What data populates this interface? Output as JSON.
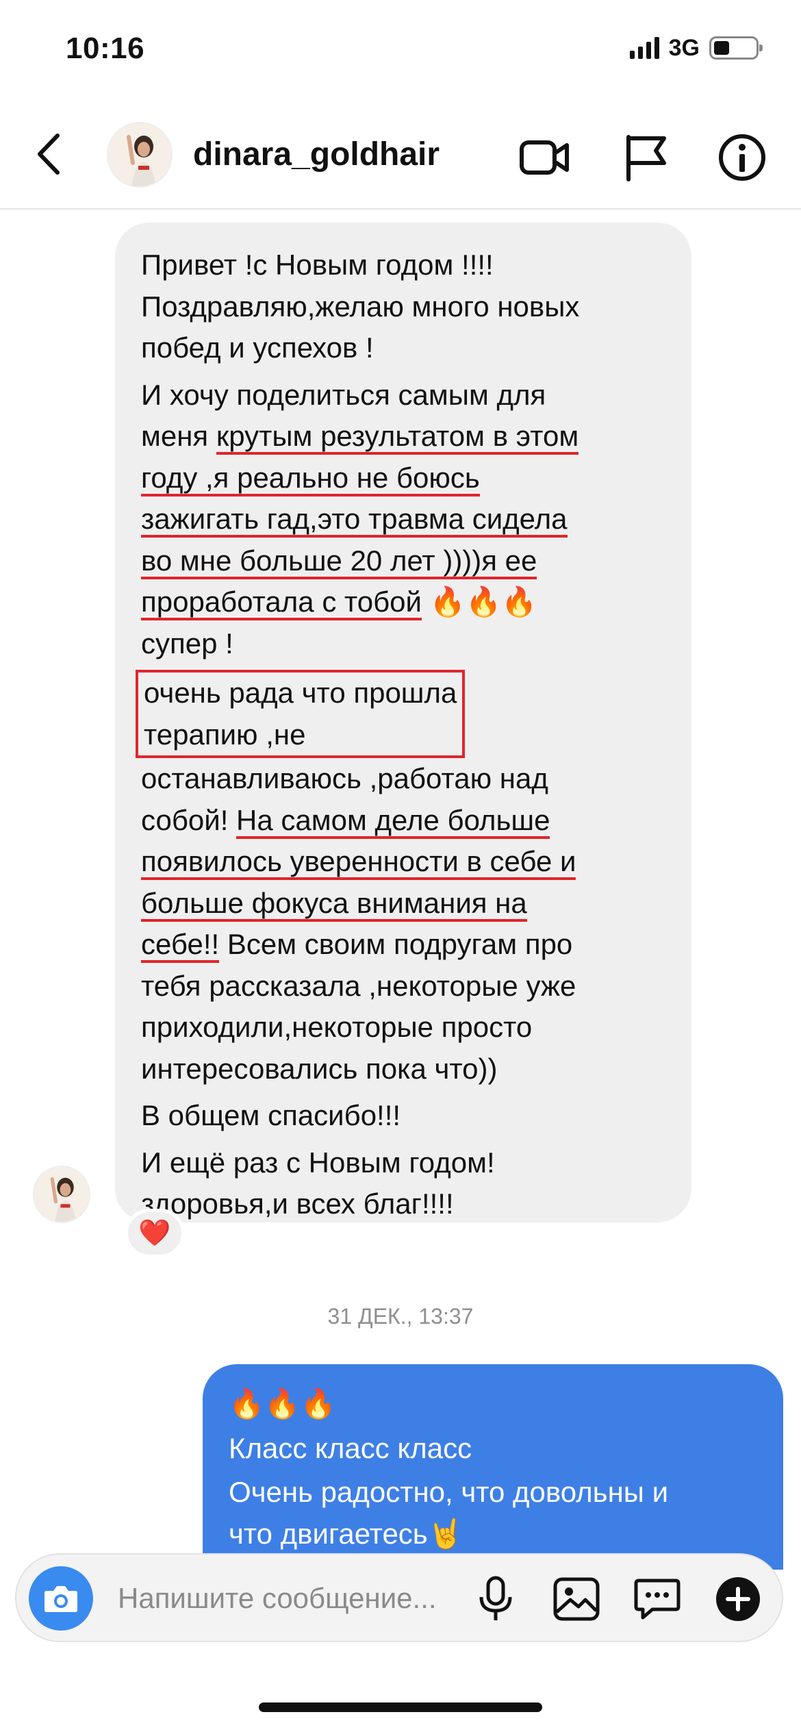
{
  "status_bar": {
    "time": "10:16",
    "network": "3G"
  },
  "header": {
    "username": "dinara_goldhair"
  },
  "incoming_message": {
    "paragraphs": [
      {
        "lines": [
          "Привет !с Новым годом !!!!",
          "Поздравляю,желаю много новых",
          "побед и успехов !"
        ]
      },
      {
        "lines": [
          {
            "pre": "И хочу поделиться самым для",
            "ul": ""
          },
          {
            "pre": "меня ",
            "ul": "крутым результатом в этом"
          },
          {
            "pre": "",
            "ul": "году ,я реально не боюсь"
          },
          {
            "pre": "",
            "ul": "зажигать гад,это травма сидела"
          },
          {
            "pre": "",
            "ul": "во мне больше 20 лет ))))я ее"
          },
          {
            "pre": "",
            "ul": "проработала с тобой",
            "post": " 🔥🔥🔥"
          },
          {
            "pre": "супер !",
            "ul": ""
          }
        ]
      },
      {
        "boxed": [
          "очень рада что прошла",
          "терапию ,не"
        ],
        "lines": [
          {
            "pre": "останавливаюсь ,работаю над",
            "ul": ""
          },
          {
            "pre": "собой! ",
            "ul": "На самом деле больше"
          },
          {
            "pre": "",
            "ul": "появилось уверенности в себе и"
          },
          {
            "pre": "",
            "ul": "больше фокуса внимания на"
          },
          {
            "pre": "",
            "ul": "себе!!",
            "post": " Всем своим подругам про"
          },
          {
            "pre": "тебя рассказала ,некоторые уже",
            "ul": ""
          },
          {
            "pre": "приходили,некоторые просто",
            "ul": ""
          },
          {
            "pre": "интересовались пока что))",
            "ul": ""
          }
        ]
      },
      {
        "lines": [
          "В общем спасибо!!!"
        ]
      },
      {
        "lines": [
          "И ещё раз с Новым годом!",
          "здоровья,и всех благ!!!!"
        ]
      }
    ],
    "reaction": "❤️"
  },
  "timestamp": "31 ДЕК., 13:37",
  "outgoing_message": {
    "paragraphs": [
      {
        "lines": [
          "🔥🔥🔥"
        ]
      },
      {
        "lines": [
          "Класс класс класс"
        ]
      },
      {
        "lines": [
          "Очень радостно, что довольны и",
          "что двигаетесь🤘"
        ]
      }
    ]
  },
  "composer": {
    "placeholder": "Напишите сообщение..."
  },
  "colors": {
    "accent_blue": "#3e7fe6",
    "underline_red": "#e0252b",
    "bubble_gray": "#efefef"
  }
}
